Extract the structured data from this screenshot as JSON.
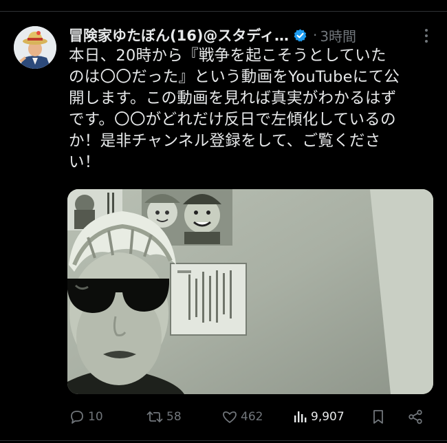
{
  "tweet": {
    "author_name": "冒険家ゆたぼん(16)@スタディ…",
    "separator": "·",
    "time": "3時間",
    "text_lines": [
      "本日、20時から『戦争を起こそうとしていた",
      "のは〇〇だった』という動画をYouTubeにて公",
      "開します。この動画を見れば真実がわかるはず",
      "です。〇〇がどれだけ反日で左傾化しているの",
      "か！是非チャンネル登録をして、ご覧くださ",
      "い！"
    ]
  },
  "actions": {
    "replies": "10",
    "reposts": "58",
    "likes": "462",
    "views": "9,907"
  },
  "icons": {
    "reply": "reply-icon",
    "repost": "repost-icon",
    "like": "heart-icon",
    "views": "views-icon",
    "bookmark": "bookmark-icon",
    "share": "share-icon",
    "verified": "verified-badge-icon",
    "more": "more-dots-icon"
  },
  "colors": {
    "background": "#000000",
    "text": "#e7e9ea",
    "muted": "#71767b",
    "verified": "#1d9bf0"
  }
}
